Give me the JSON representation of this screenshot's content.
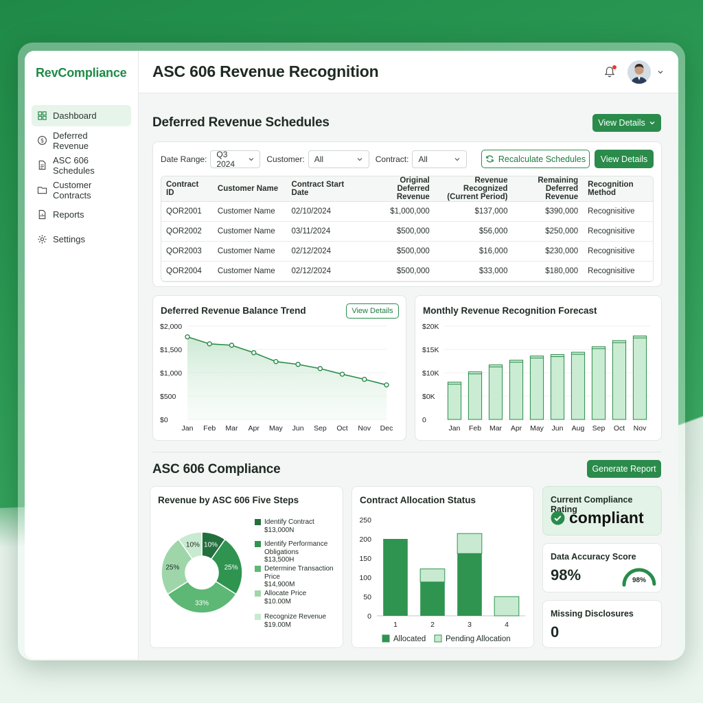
{
  "app": {
    "brand": "RevCompliance",
    "title": "ASC 606 Revenue Recognition"
  },
  "sidebar": {
    "items": [
      {
        "label": "Dashboard",
        "icon": "grid-icon",
        "active": true
      },
      {
        "label": "Deferred Revenue",
        "icon": "dollar-circle-icon"
      },
      {
        "label": "ASC 606 Schedules",
        "icon": "document-icon"
      },
      {
        "label": "Customer Contracts",
        "icon": "folder-icon"
      },
      {
        "label": "Reports",
        "icon": "report-icon"
      },
      {
        "label": "Settings",
        "icon": "gear-icon"
      }
    ]
  },
  "schedules": {
    "title": "Deferred Revenue Schedules",
    "view_details": "View Details",
    "filters": {
      "date_label": "Date Range:",
      "date_value": "Q3 2024",
      "customer_label": "Customer:",
      "customer_value": "All",
      "contract_label": "Contract:",
      "contract_value": "All"
    },
    "recalc_label": "Recalculate Schedules",
    "view_details2": "View Details",
    "columns": [
      "Contract ID",
      "Customer Name",
      "Contract Start Date",
      "Original Deferred Revenue",
      "Revenue Recognized (Current Period)",
      "Remaining Deferred Revenue",
      "Recognition Method"
    ],
    "rows": [
      [
        "QOR2001",
        "Customer Name",
        "02/10/2024",
        "$1,000,000",
        "$137,000",
        "$390,000",
        "Recognisitive"
      ],
      [
        "QOR2002",
        "Customer Name",
        "03/11/2024",
        "$500,000",
        "$56,000",
        "$250,000",
        "Recognisitive"
      ],
      [
        "QOR2003",
        "Customer Name",
        "02/12/2024",
        "$500,000",
        "$16,000",
        "$230,000",
        "Recognisitive"
      ],
      [
        "QOR2004",
        "Customer Name",
        "02/12/2024",
        "$500,000",
        "$33,000",
        "$180,000",
        "Recognisitive"
      ]
    ]
  },
  "trend": {
    "title": "Deferred Revenue Balance Trend",
    "view_details": "View Details"
  },
  "forecast": {
    "title": "Monthly Revenue Recognition Forecast"
  },
  "compliance": {
    "title": "ASC 606 Compliance",
    "generate": "Generate Report",
    "rating_label": "Current Compliance Rating",
    "rating_value": "compliant",
    "accuracy_label": "Data Accuracy Score",
    "accuracy_value": "98%",
    "accuracy_gauge": "98%",
    "accuracy_fraction": 0.98,
    "missing_label": "Missing Disclosures",
    "missing_value": "0"
  },
  "steps": {
    "title": "Revenue by ASC 606 Five Steps"
  },
  "allocation": {
    "title": "Contract Allocation Status"
  },
  "chart_data": [
    {
      "type": "line",
      "title": "Deferred Revenue Balance Trend",
      "x": [
        "Jan",
        "Feb",
        "Mar",
        "Apr",
        "May",
        "Jun",
        "Sep",
        "Oct",
        "Nov",
        "Dec"
      ],
      "values": [
        1770,
        1620,
        1590,
        1430,
        1240,
        1180,
        1090,
        970,
        860,
        740
      ],
      "ylim": [
        0,
        2000
      ],
      "yticks": [
        "$0",
        "$500",
        "$1,000",
        "$1,500",
        "$2,000"
      ],
      "color": "#2a8b4b"
    },
    {
      "type": "bar",
      "title": "Monthly Revenue Recognition Forecast",
      "categories": [
        "Jan",
        "Feb",
        "Mar",
        "Apr",
        "May",
        "Jun",
        "Aug",
        "Sep",
        "Oct",
        "Nov"
      ],
      "values": [
        8000,
        10200,
        11700,
        12700,
        13600,
        13900,
        14400,
        15600,
        16900,
        17900
      ],
      "ylim": [
        0,
        20000
      ],
      "yticks": [
        "0",
        "$0K",
        "$10K",
        "$15K",
        "$20K"
      ],
      "color": "#c9ecd2"
    },
    {
      "type": "pie",
      "title": "Revenue by ASC 606 Five Steps",
      "slices": [
        {
          "name": "Identify Contract",
          "value": "$13,000N",
          "pct": 10,
          "label": "10%",
          "color": "#236f3d"
        },
        {
          "name": "Identify Performance Obligations",
          "value": "$13,500H",
          "pct": 25,
          "label": "25%",
          "color": "#2f9450"
        },
        {
          "name": "Determine Transaction Price",
          "value": "$14,900M",
          "pct": 33,
          "label": "33%",
          "color": "#5cb874"
        },
        {
          "name": "Allocate Price",
          "value": "$10.00M",
          "pct": 25,
          "label": "25%",
          "color": "#9ed6aa"
        },
        {
          "name": "Recognize Revenue",
          "value": "$19.00M",
          "pct": 10,
          "label": "10%",
          "color": "#c8ead0"
        }
      ]
    },
    {
      "type": "bar",
      "stacked": true,
      "title": "Contract Allocation Status",
      "categories": [
        "1",
        "2",
        "3",
        "4"
      ],
      "series": [
        {
          "name": "Allocated",
          "values": [
            200,
            88,
            162,
            0
          ],
          "color": "#2f9450"
        },
        {
          "name": "Pending Allocation",
          "values": [
            0,
            34,
            52,
            50
          ],
          "color": "#c8ead0"
        }
      ],
      "ylim": [
        0,
        250
      ],
      "yticks": [
        "0",
        "50",
        "100",
        "150",
        "200",
        "250"
      ]
    }
  ]
}
